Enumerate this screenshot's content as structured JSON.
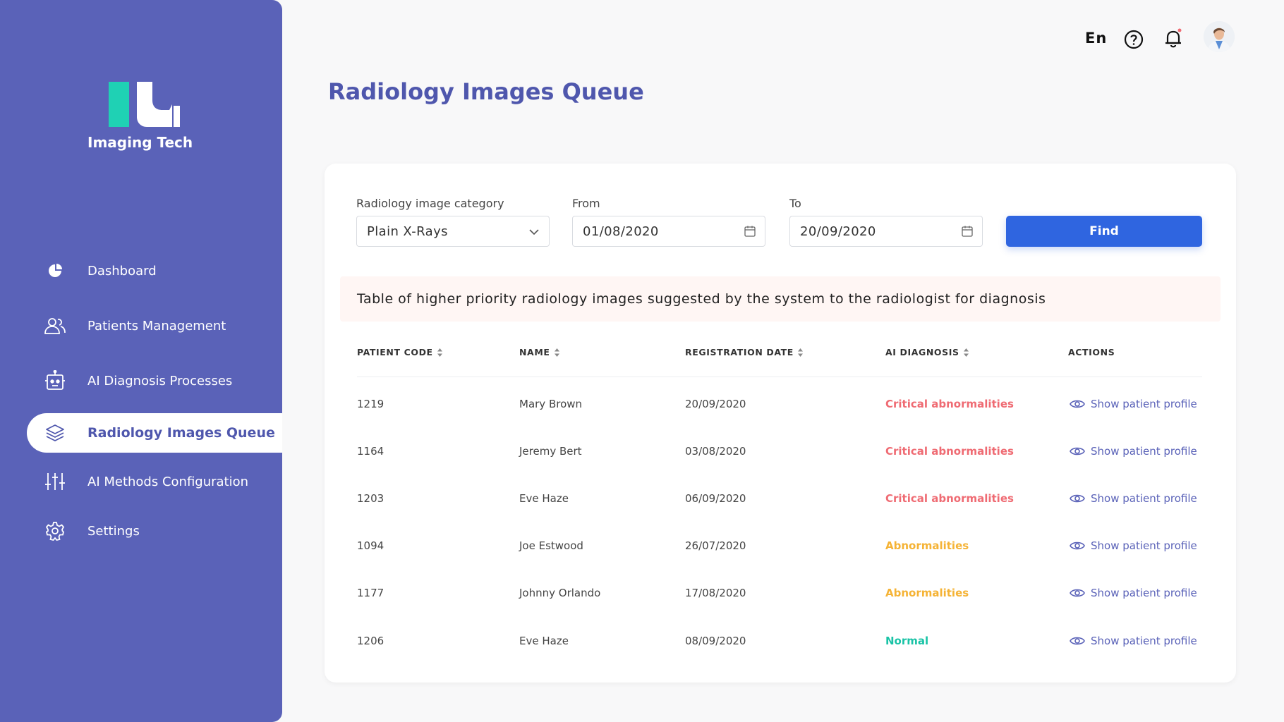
{
  "app": {
    "name": "Imaging Tech",
    "colors": {
      "sidebar": "#5a62b8",
      "accent": "#4f57ad",
      "primary_button": "#2f65e0",
      "critical": "#ef6b73",
      "abnormal": "#f5b335",
      "normal": "#19c3a6"
    }
  },
  "sidebar": {
    "items": [
      {
        "label": "Dashboard",
        "icon": "pie-chart-icon"
      },
      {
        "label": "Patients Management",
        "icon": "users-icon"
      },
      {
        "label": "AI Diagnosis Processes",
        "icon": "robot-icon"
      },
      {
        "label": "Radiology Images Queue",
        "icon": "layers-icon",
        "active": true
      },
      {
        "label": "AI Methods Configuration",
        "icon": "sliders-icon"
      },
      {
        "label": "Settings",
        "icon": "gear-icon"
      }
    ]
  },
  "header": {
    "language": "En",
    "icons": [
      "help-icon",
      "bell-icon",
      "avatar"
    ]
  },
  "page": {
    "title": "Radiology Images Queue"
  },
  "filters": {
    "category": {
      "label": "Radiology image category",
      "value": "Plain X-Rays"
    },
    "from": {
      "label": "From",
      "value": "01/08/2020"
    },
    "to": {
      "label": "To",
      "value": "20/09/2020"
    },
    "find_label": "Find"
  },
  "notice": "Table of higher priority radiology images suggested by the system to the radiologist for diagnosis",
  "table": {
    "headers": [
      "PATIENT CODE",
      "NAME",
      "REGISTRATION DATE",
      "AI DIAGNOSIS",
      "ACTIONS"
    ],
    "rows": [
      {
        "code": "1219",
        "name": "Mary Brown",
        "date": "20/09/2020",
        "diagnosis": "Critical abnormalities",
        "level": "critical",
        "action": "Show patient profile"
      },
      {
        "code": "1164",
        "name": "Jeremy Bert",
        "date": "03/08/2020",
        "diagnosis": "Critical abnormalities",
        "level": "critical",
        "action": "Show patient profile"
      },
      {
        "code": "1203",
        "name": "Eve Haze",
        "date": "06/09/2020",
        "diagnosis": "Critical abnormalities",
        "level": "critical",
        "action": "Show patient profile"
      },
      {
        "code": "1094",
        "name": "Joe Estwood",
        "date": "26/07/2020",
        "diagnosis": "Abnormalities",
        "level": "abnormal",
        "action": "Show patient profile"
      },
      {
        "code": "1177",
        "name": "Johnny Orlando",
        "date": "17/08/2020",
        "diagnosis": "Abnormalities",
        "level": "abnormal",
        "action": "Show patient profile"
      },
      {
        "code": "1206",
        "name": "Eve Haze",
        "date": "08/09/2020",
        "diagnosis": "Normal",
        "level": "normal",
        "action": "Show patient profile"
      }
    ]
  }
}
